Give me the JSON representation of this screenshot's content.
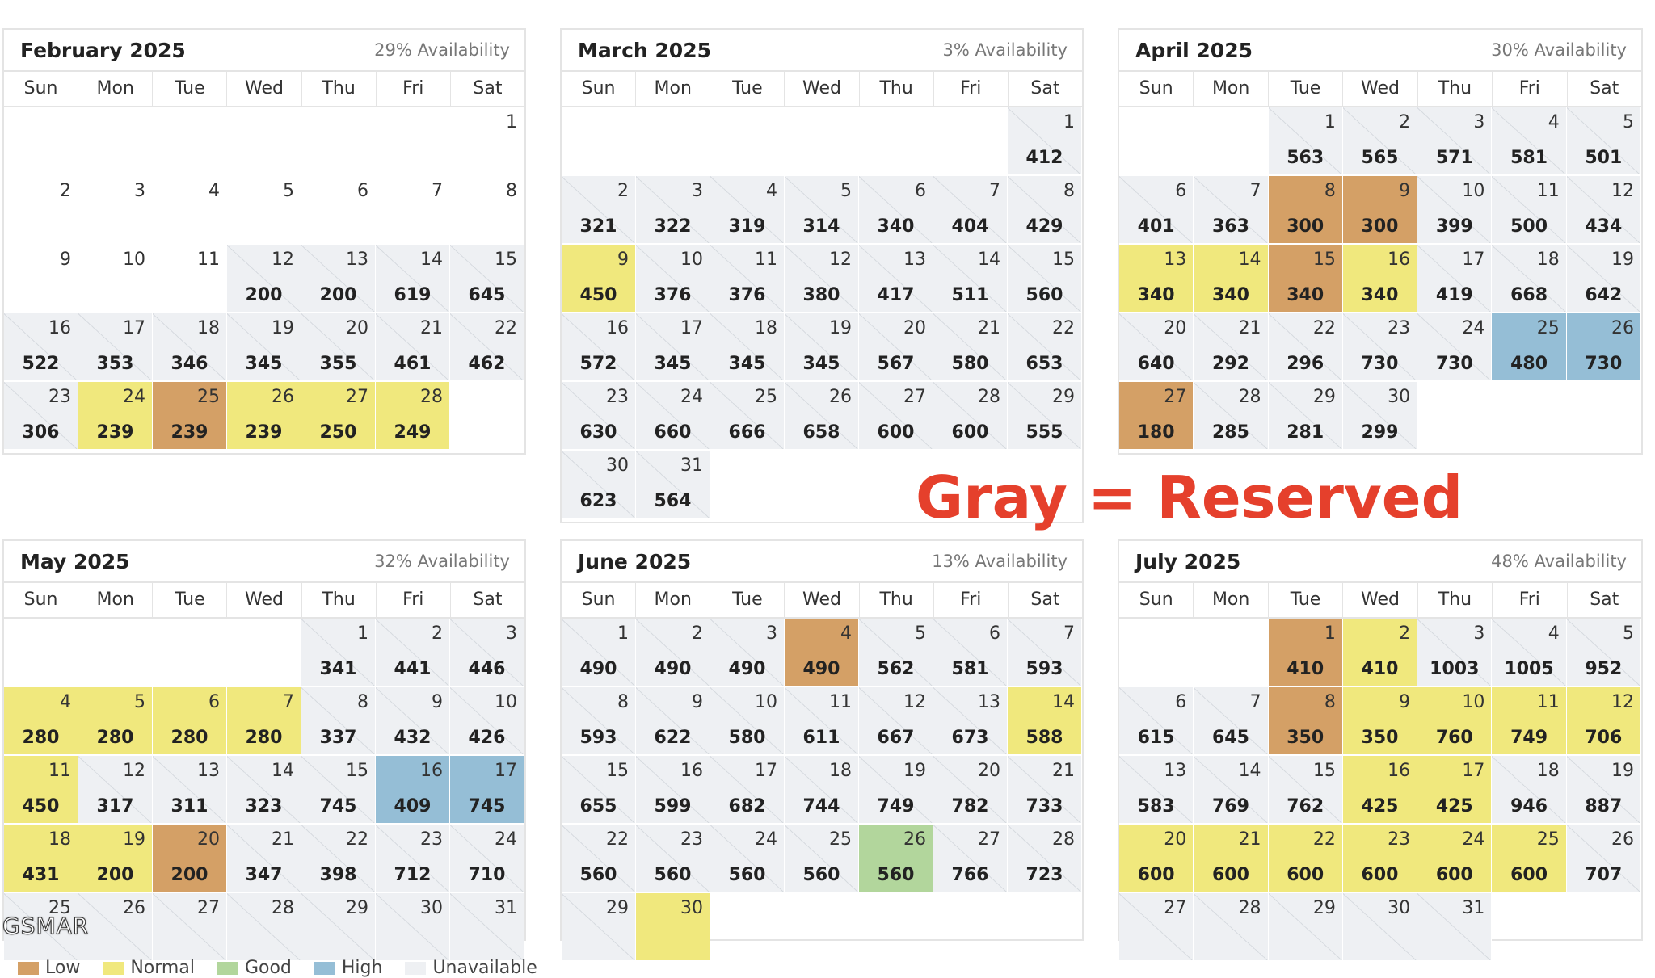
{
  "weekdays": [
    "Sun",
    "Mon",
    "Tue",
    "Wed",
    "Thu",
    "Fri",
    "Sat"
  ],
  "colors": {
    "low": "#d4a066",
    "normal": "#f0e87d",
    "good": "#b2d69c",
    "high": "#95bed6",
    "reserved": "#eef0f3",
    "annotation": "#e5402c"
  },
  "calendars": [
    {
      "title": "February 2025",
      "availability": "29% Availability",
      "start": 6,
      "days": [
        {
          "d": "1",
          "p": "",
          "s": "empty"
        },
        {
          "d": "2",
          "p": "",
          "s": "empty"
        },
        {
          "d": "3",
          "p": "",
          "s": "empty"
        },
        {
          "d": "4",
          "p": "",
          "s": "empty"
        },
        {
          "d": "5",
          "p": "",
          "s": "empty"
        },
        {
          "d": "6",
          "p": "",
          "s": "empty"
        },
        {
          "d": "7",
          "p": "",
          "s": "empty"
        },
        {
          "d": "8",
          "p": "",
          "s": "empty"
        },
        {
          "d": "9",
          "p": "",
          "s": "empty"
        },
        {
          "d": "10",
          "p": "",
          "s": "empty"
        },
        {
          "d": "11",
          "p": "",
          "s": "empty"
        },
        {
          "d": "12",
          "p": "200",
          "s": "r"
        },
        {
          "d": "13",
          "p": "200",
          "s": "r"
        },
        {
          "d": "14",
          "p": "619",
          "s": "r"
        },
        {
          "d": "15",
          "p": "645",
          "s": "r"
        },
        {
          "d": "16",
          "p": "522",
          "s": "r"
        },
        {
          "d": "17",
          "p": "353",
          "s": "r"
        },
        {
          "d": "18",
          "p": "346",
          "s": "r"
        },
        {
          "d": "19",
          "p": "345",
          "s": "r"
        },
        {
          "d": "20",
          "p": "355",
          "s": "r"
        },
        {
          "d": "21",
          "p": "461",
          "s": "r"
        },
        {
          "d": "22",
          "p": "462",
          "s": "r"
        },
        {
          "d": "23",
          "p": "306",
          "s": "r"
        },
        {
          "d": "24",
          "p": "239",
          "s": "normal"
        },
        {
          "d": "25",
          "p": "239",
          "s": "low"
        },
        {
          "d": "26",
          "p": "239",
          "s": "normal"
        },
        {
          "d": "27",
          "p": "250",
          "s": "normal"
        },
        {
          "d": "28",
          "p": "249",
          "s": "normal"
        }
      ]
    },
    {
      "title": "March 2025",
      "availability": "3% Availability",
      "start": 6,
      "days": [
        {
          "d": "1",
          "p": "412",
          "s": "r"
        },
        {
          "d": "2",
          "p": "321",
          "s": "r"
        },
        {
          "d": "3",
          "p": "322",
          "s": "r"
        },
        {
          "d": "4",
          "p": "319",
          "s": "r"
        },
        {
          "d": "5",
          "p": "314",
          "s": "r"
        },
        {
          "d": "6",
          "p": "340",
          "s": "r"
        },
        {
          "d": "7",
          "p": "404",
          "s": "r"
        },
        {
          "d": "8",
          "p": "429",
          "s": "r"
        },
        {
          "d": "9",
          "p": "450",
          "s": "normal"
        },
        {
          "d": "10",
          "p": "376",
          "s": "r"
        },
        {
          "d": "11",
          "p": "376",
          "s": "r"
        },
        {
          "d": "12",
          "p": "380",
          "s": "r"
        },
        {
          "d": "13",
          "p": "417",
          "s": "r"
        },
        {
          "d": "14",
          "p": "511",
          "s": "r"
        },
        {
          "d": "15",
          "p": "560",
          "s": "r"
        },
        {
          "d": "16",
          "p": "572",
          "s": "r"
        },
        {
          "d": "17",
          "p": "345",
          "s": "r"
        },
        {
          "d": "18",
          "p": "345",
          "s": "r"
        },
        {
          "d": "19",
          "p": "345",
          "s": "r"
        },
        {
          "d": "20",
          "p": "567",
          "s": "r"
        },
        {
          "d": "21",
          "p": "580",
          "s": "r"
        },
        {
          "d": "22",
          "p": "653",
          "s": "r"
        },
        {
          "d": "23",
          "p": "630",
          "s": "r"
        },
        {
          "d": "24",
          "p": "660",
          "s": "r"
        },
        {
          "d": "25",
          "p": "666",
          "s": "r"
        },
        {
          "d": "26",
          "p": "658",
          "s": "r"
        },
        {
          "d": "27",
          "p": "600",
          "s": "r"
        },
        {
          "d": "28",
          "p": "600",
          "s": "r"
        },
        {
          "d": "29",
          "p": "555",
          "s": "r"
        },
        {
          "d": "30",
          "p": "623",
          "s": "r"
        },
        {
          "d": "31",
          "p": "564",
          "s": "r"
        }
      ]
    },
    {
      "title": "April 2025",
      "availability": "30% Availability",
      "start": 2,
      "days": [
        {
          "d": "1",
          "p": "563",
          "s": "r"
        },
        {
          "d": "2",
          "p": "565",
          "s": "r"
        },
        {
          "d": "3",
          "p": "571",
          "s": "r"
        },
        {
          "d": "4",
          "p": "581",
          "s": "r"
        },
        {
          "d": "5",
          "p": "501",
          "s": "r"
        },
        {
          "d": "6",
          "p": "401",
          "s": "r"
        },
        {
          "d": "7",
          "p": "363",
          "s": "r"
        },
        {
          "d": "8",
          "p": "300",
          "s": "low"
        },
        {
          "d": "9",
          "p": "300",
          "s": "low"
        },
        {
          "d": "10",
          "p": "399",
          "s": "r"
        },
        {
          "d": "11",
          "p": "500",
          "s": "r"
        },
        {
          "d": "12",
          "p": "434",
          "s": "r"
        },
        {
          "d": "13",
          "p": "340",
          "s": "normal"
        },
        {
          "d": "14",
          "p": "340",
          "s": "normal"
        },
        {
          "d": "15",
          "p": "340",
          "s": "low"
        },
        {
          "d": "16",
          "p": "340",
          "s": "normal"
        },
        {
          "d": "17",
          "p": "419",
          "s": "r"
        },
        {
          "d": "18",
          "p": "668",
          "s": "r"
        },
        {
          "d": "19",
          "p": "642",
          "s": "r"
        },
        {
          "d": "20",
          "p": "640",
          "s": "r"
        },
        {
          "d": "21",
          "p": "292",
          "s": "r"
        },
        {
          "d": "22",
          "p": "296",
          "s": "r"
        },
        {
          "d": "23",
          "p": "730",
          "s": "r"
        },
        {
          "d": "24",
          "p": "730",
          "s": "r"
        },
        {
          "d": "25",
          "p": "480",
          "s": "high"
        },
        {
          "d": "26",
          "p": "730",
          "s": "high"
        },
        {
          "d": "27",
          "p": "180",
          "s": "low"
        },
        {
          "d": "28",
          "p": "285",
          "s": "r"
        },
        {
          "d": "29",
          "p": "281",
          "s": "r"
        },
        {
          "d": "30",
          "p": "299",
          "s": "r"
        }
      ]
    },
    {
      "title": "May 2025",
      "availability": "32% Availability",
      "start": 4,
      "days": [
        {
          "d": "1",
          "p": "341",
          "s": "r"
        },
        {
          "d": "2",
          "p": "441",
          "s": "r"
        },
        {
          "d": "3",
          "p": "446",
          "s": "r"
        },
        {
          "d": "4",
          "p": "280",
          "s": "normal"
        },
        {
          "d": "5",
          "p": "280",
          "s": "normal"
        },
        {
          "d": "6",
          "p": "280",
          "s": "normal"
        },
        {
          "d": "7",
          "p": "280",
          "s": "normal"
        },
        {
          "d": "8",
          "p": "337",
          "s": "r"
        },
        {
          "d": "9",
          "p": "432",
          "s": "r"
        },
        {
          "d": "10",
          "p": "426",
          "s": "r"
        },
        {
          "d": "11",
          "p": "450",
          "s": "normal"
        },
        {
          "d": "12",
          "p": "317",
          "s": "r"
        },
        {
          "d": "13",
          "p": "311",
          "s": "r"
        },
        {
          "d": "14",
          "p": "323",
          "s": "r"
        },
        {
          "d": "15",
          "p": "745",
          "s": "r"
        },
        {
          "d": "16",
          "p": "409",
          "s": "high"
        },
        {
          "d": "17",
          "p": "745",
          "s": "high"
        },
        {
          "d": "18",
          "p": "431",
          "s": "normal"
        },
        {
          "d": "19",
          "p": "200",
          "s": "normal"
        },
        {
          "d": "20",
          "p": "200",
          "s": "low"
        },
        {
          "d": "21",
          "p": "347",
          "s": "r"
        },
        {
          "d": "22",
          "p": "398",
          "s": "r"
        },
        {
          "d": "23",
          "p": "712",
          "s": "r"
        },
        {
          "d": "24",
          "p": "710",
          "s": "r"
        },
        {
          "d": "25",
          "p": "",
          "s": "r"
        },
        {
          "d": "26",
          "p": "",
          "s": "r"
        },
        {
          "d": "27",
          "p": "",
          "s": "r"
        },
        {
          "d": "28",
          "p": "",
          "s": "r"
        },
        {
          "d": "29",
          "p": "",
          "s": "r"
        },
        {
          "d": "30",
          "p": "",
          "s": "r"
        },
        {
          "d": "31",
          "p": "",
          "s": "r"
        }
      ]
    },
    {
      "title": "June 2025",
      "availability": "13% Availability",
      "start": 0,
      "days": [
        {
          "d": "1",
          "p": "490",
          "s": "r"
        },
        {
          "d": "2",
          "p": "490",
          "s": "r"
        },
        {
          "d": "3",
          "p": "490",
          "s": "r"
        },
        {
          "d": "4",
          "p": "490",
          "s": "low"
        },
        {
          "d": "5",
          "p": "562",
          "s": "r"
        },
        {
          "d": "6",
          "p": "581",
          "s": "r"
        },
        {
          "d": "7",
          "p": "593",
          "s": "r"
        },
        {
          "d": "8",
          "p": "593",
          "s": "r"
        },
        {
          "d": "9",
          "p": "622",
          "s": "r"
        },
        {
          "d": "10",
          "p": "580",
          "s": "r"
        },
        {
          "d": "11",
          "p": "611",
          "s": "r"
        },
        {
          "d": "12",
          "p": "667",
          "s": "r"
        },
        {
          "d": "13",
          "p": "673",
          "s": "r"
        },
        {
          "d": "14",
          "p": "588",
          "s": "normal"
        },
        {
          "d": "15",
          "p": "655",
          "s": "r"
        },
        {
          "d": "16",
          "p": "599",
          "s": "r"
        },
        {
          "d": "17",
          "p": "682",
          "s": "r"
        },
        {
          "d": "18",
          "p": "744",
          "s": "r"
        },
        {
          "d": "19",
          "p": "749",
          "s": "r"
        },
        {
          "d": "20",
          "p": "782",
          "s": "r"
        },
        {
          "d": "21",
          "p": "733",
          "s": "r"
        },
        {
          "d": "22",
          "p": "560",
          "s": "r"
        },
        {
          "d": "23",
          "p": "560",
          "s": "r"
        },
        {
          "d": "24",
          "p": "560",
          "s": "r"
        },
        {
          "d": "25",
          "p": "560",
          "s": "r"
        },
        {
          "d": "26",
          "p": "560",
          "s": "good"
        },
        {
          "d": "27",
          "p": "766",
          "s": "r"
        },
        {
          "d": "28",
          "p": "723",
          "s": "r"
        },
        {
          "d": "29",
          "p": "",
          "s": "r"
        },
        {
          "d": "30",
          "p": "",
          "s": "normal"
        }
      ]
    },
    {
      "title": "July 2025",
      "availability": "48% Availability",
      "start": 2,
      "days": [
        {
          "d": "1",
          "p": "410",
          "s": "low"
        },
        {
          "d": "2",
          "p": "410",
          "s": "normal"
        },
        {
          "d": "3",
          "p": "1003",
          "s": "r"
        },
        {
          "d": "4",
          "p": "1005",
          "s": "r"
        },
        {
          "d": "5",
          "p": "952",
          "s": "r"
        },
        {
          "d": "6",
          "p": "615",
          "s": "r"
        },
        {
          "d": "7",
          "p": "645",
          "s": "r"
        },
        {
          "d": "8",
          "p": "350",
          "s": "low"
        },
        {
          "d": "9",
          "p": "350",
          "s": "normal"
        },
        {
          "d": "10",
          "p": "760",
          "s": "normal"
        },
        {
          "d": "11",
          "p": "749",
          "s": "normal"
        },
        {
          "d": "12",
          "p": "706",
          "s": "normal"
        },
        {
          "d": "13",
          "p": "583",
          "s": "r"
        },
        {
          "d": "14",
          "p": "769",
          "s": "r"
        },
        {
          "d": "15",
          "p": "762",
          "s": "r"
        },
        {
          "d": "16",
          "p": "425",
          "s": "normal"
        },
        {
          "d": "17",
          "p": "425",
          "s": "normal"
        },
        {
          "d": "18",
          "p": "946",
          "s": "r"
        },
        {
          "d": "19",
          "p": "887",
          "s": "r"
        },
        {
          "d": "20",
          "p": "600",
          "s": "normal"
        },
        {
          "d": "21",
          "p": "600",
          "s": "normal"
        },
        {
          "d": "22",
          "p": "600",
          "s": "normal"
        },
        {
          "d": "23",
          "p": "600",
          "s": "normal"
        },
        {
          "d": "24",
          "p": "600",
          "s": "normal"
        },
        {
          "d": "25",
          "p": "600",
          "s": "normal"
        },
        {
          "d": "26",
          "p": "707",
          "s": "r"
        },
        {
          "d": "27",
          "p": "",
          "s": "r"
        },
        {
          "d": "28",
          "p": "",
          "s": "r"
        },
        {
          "d": "29",
          "p": "",
          "s": "r"
        },
        {
          "d": "30",
          "p": "",
          "s": "r"
        },
        {
          "d": "31",
          "p": "",
          "s": "r"
        }
      ]
    }
  ],
  "annotation": "Gray = Reserved",
  "watermark": "GSMAR",
  "legend": [
    {
      "label": "Low",
      "swatch": "low"
    },
    {
      "label": "Normal",
      "swatch": "normal"
    },
    {
      "label": "Good",
      "swatch": "good"
    },
    {
      "label": "High",
      "swatch": "high"
    },
    {
      "label": "Unavailable",
      "swatch": "reserved"
    }
  ]
}
